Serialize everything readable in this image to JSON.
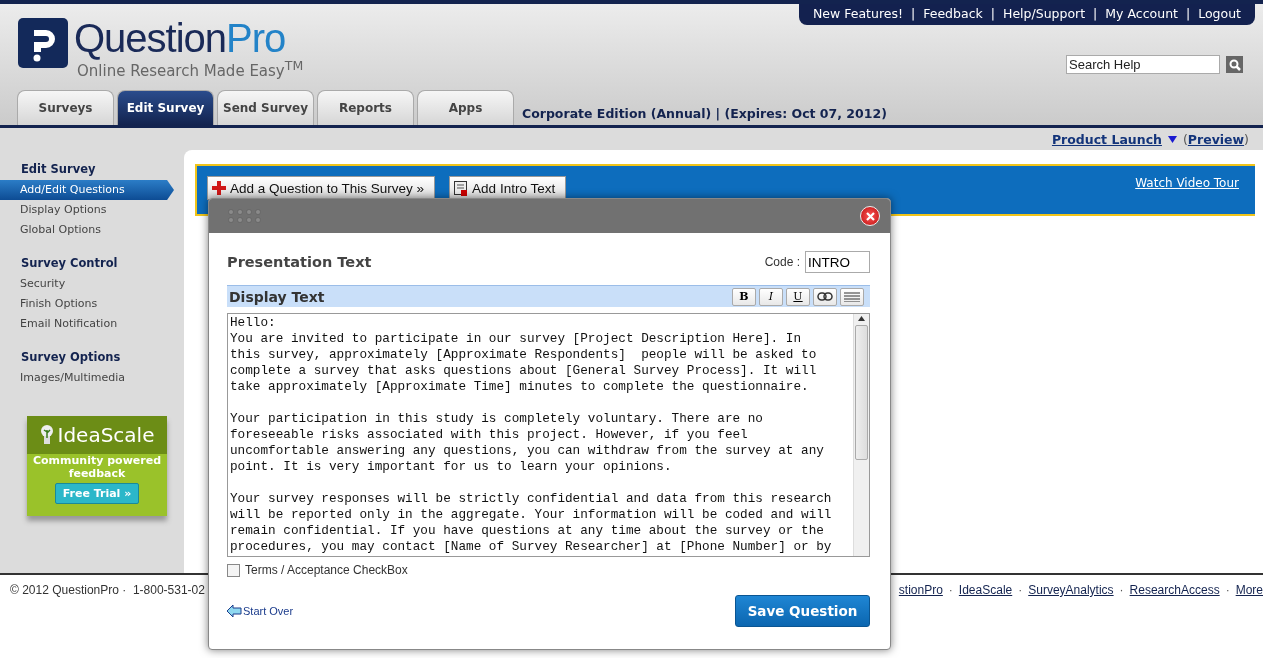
{
  "top_links": [
    "New Features!",
    "Feedback",
    "Help/Support",
    "My Account",
    "Logout"
  ],
  "top_links_separator": "|",
  "logo": {
    "name_main": "Question",
    "name_accent": "Pro",
    "tagline": "Online Research Made Easy$^{TM}$"
  },
  "search": {
    "placeholder": "Search Help"
  },
  "tabs": [
    {
      "label": "Surveys",
      "selected": false
    },
    {
      "label": "Edit Survey",
      "selected": true
    },
    {
      "label": "Send Survey",
      "selected": false
    },
    {
      "label": "Reports",
      "selected": false
    },
    {
      "label": "Apps",
      "selected": false
    }
  ],
  "edition": "Corporate Edition (Annual) | (Expires: Oct 07, 2012)",
  "survey_bar": {
    "survey_name": "Product Launch",
    "preview_open": "(",
    "preview": "Preview",
    "preview_close": ")"
  },
  "sidebar": [
    {
      "heading": "Edit Survey",
      "items": [
        {
          "label": "Add/Edit Questions",
          "selected": true
        },
        {
          "label": "Display Options",
          "selected": false
        },
        {
          "label": "Global Options",
          "selected": false
        }
      ]
    },
    {
      "heading": "Survey Control",
      "items": [
        {
          "label": "Security",
          "selected": false
        },
        {
          "label": "Finish Options",
          "selected": false
        },
        {
          "label": "Email Notification",
          "selected": false
        }
      ]
    },
    {
      "heading": "Survey Options",
      "items": [
        {
          "label": "Images/Multimedia",
          "selected": false
        }
      ]
    }
  ],
  "ad": {
    "brand": "IdeaScale",
    "text": "Community powered feedback",
    "button": "Free Trial »"
  },
  "toolbar": {
    "buttons": [
      {
        "label": "Add a Question to This Survey »",
        "kind": "add"
      },
      {
        "label": "Add Intro Text",
        "kind": "intro"
      }
    ],
    "video_link": "Watch Video Tour"
  },
  "modal": {
    "title": "Presentation Text",
    "code_label": "Code :",
    "code_value": "INTRO",
    "editor_label": "Display Text",
    "format_buttons": [
      {
        "label": "B",
        "kind": "bold"
      },
      {
        "label": "I",
        "kind": "italic"
      },
      {
        "label": "U",
        "kind": "underline"
      },
      {
        "kind": "link"
      },
      {
        "kind": "align"
      }
    ],
    "text": "Hello:\nYou are invited to participate in our survey [Project Description Here]. In\nthis survey, approximately [Approximate Respondents]  people will be asked to\ncomplete a survey that asks questions about [General Survey Process]. It will\ntake approximately [Approximate Time] minutes to complete the questionnaire.\n\nYour participation in this study is completely voluntary. There are no\nforeseeable risks associated with this project. However, if you feel\nuncomfortable answering any questions, you can withdraw from the survey at any\npoint. It is very important for us to learn your opinions.\n\nYour survey responses will be strictly confidential and data from this research\nwill be reported only in the aggregate. Your information will be coded and will\nremain confidential. If you have questions at any time about the survey or the\nprocedures, you may contact [Name of Survey Researcher] at [Phone Number] or by",
    "checkbox": {
      "label": "Terms / Acceptance CheckBox",
      "checked": false
    },
    "back_link": "Start Over",
    "save_button": "Save Question"
  },
  "footer": {
    "left": "© 2012 QuestionPro ·  1-800-531-02",
    "links": [
      "stionPro",
      "IdeaScale",
      "SurveyAnalytics",
      "ResearchAccess",
      "More"
    ],
    "separator": "·"
  }
}
